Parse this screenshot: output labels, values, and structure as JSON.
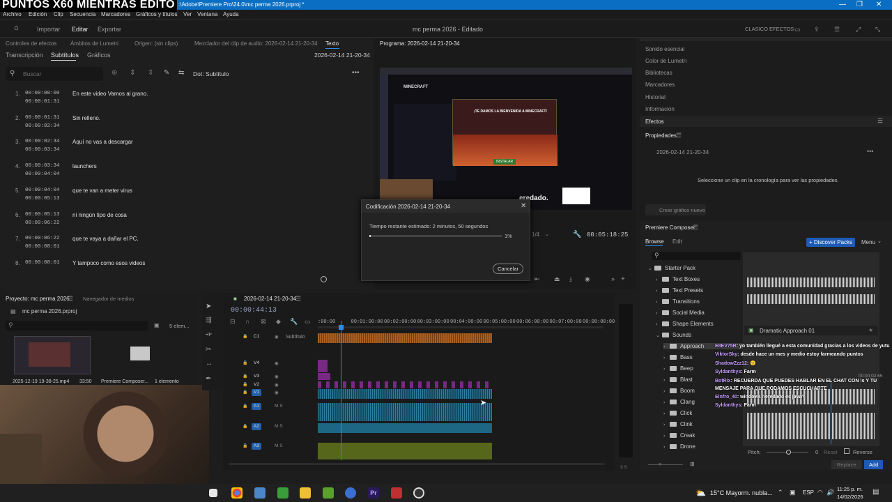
{
  "window": {
    "overlay_text": "PUNTOS X60 MIENTRAS EDITO",
    "path": ":\\Adobe\\Premiere Pro\\24.0\\mc perma 2026.prproj *"
  },
  "menu": [
    "Archivo",
    "Edición",
    "Clip",
    "Secuencia",
    "Marcadores",
    "Gráficos y títulos",
    "Ver",
    "Ventana",
    "Ayuda"
  ],
  "header": {
    "tabs": [
      "Importar",
      "Editar",
      "Exportar"
    ],
    "project_title": "mc perma 2026 - Editado",
    "workspace": "CLASICO EFECTOS"
  },
  "source_tabs": [
    "Controles de efectos",
    "Ámbitos de Lumetri",
    "Origen: (sin clips)",
    "Mezclador del clip de audio: 2026-02-14 21-20-34",
    "Texto"
  ],
  "text_panel": {
    "subtabs": [
      "Transcripción",
      "Subtítulos",
      "Gráficos"
    ],
    "sequence": "2026-02-14 21-20-34",
    "search_placeholder": "Buscar",
    "track_label": "Dot: Subtítulo",
    "rows": [
      {
        "n": "1.",
        "t1": "00:00:00:00",
        "t2": "00:00:01:31",
        "text": "En este video Vamos al grano."
      },
      {
        "n": "2.",
        "t1": "00:00:01:31",
        "t2": "00:00:02:34",
        "text": "Sin relleno."
      },
      {
        "n": "3.",
        "t1": "00:00:02:34",
        "t2": "00:00:03:34",
        "text": "Aquí no vas a descargar"
      },
      {
        "n": "4.",
        "t1": "00:00:03:34",
        "t2": "00:00:04:04",
        "text": "launchers"
      },
      {
        "n": "5.",
        "t1": "00:00:04:04",
        "t2": "00:00:05:13",
        "text": "que te van a meter virus"
      },
      {
        "n": "6.",
        "t1": "00:00:05:13",
        "t2": "00:00:06:22",
        "text": "ni ningún tipo de cosa"
      },
      {
        "n": "7.",
        "t1": "00:00:06:22",
        "t2": "00:00:08:01",
        "text": "que te vaya a dañar el PC."
      },
      {
        "n": "8.",
        "t1": "00:00:08:01",
        "t2": "",
        "text": "Y tampoco como esos videos"
      }
    ]
  },
  "program": {
    "title": "Programa: 2026-02-14 21-20-34",
    "timecode": "00:05:18:25",
    "fit": "1/4",
    "preview": {
      "heading": "¡TE DAMOS LA BIENVENIDA A MINECRAFT!",
      "button": "INSTALAR",
      "brand": "MINECRAFT",
      "overlay": "eredado."
    }
  },
  "encode_dialog": {
    "title": "Codificación 2026-02-14 21-20-34",
    "remaining": "Tiempo restante estimado: 2 minutos, 50 segundos",
    "percent": "1%",
    "progress": 0.01,
    "cancel": "Cancelar"
  },
  "right_panel": {
    "items": [
      "Sonido esencial",
      "Color de Lumetri",
      "Bibliotecas",
      "Marcadores",
      "Historial",
      "Información"
    ],
    "effects": "Efectos",
    "properties": "Propiedades",
    "seq_name": "2026-02-14 21-20-34",
    "hint": "Seleccione un clip en la cronología para ver las propiedades.",
    "create_btn": "Crear gráfico nuevo"
  },
  "composer": {
    "title": "Premiere Composer",
    "tabs": [
      "Browse",
      "Edit"
    ],
    "discover": "+ Discover Packs",
    "menu": "Menu",
    "tree": [
      {
        "label": "Starter Pack",
        "level": 0,
        "open": true
      },
      {
        "label": "Text Boxes",
        "level": 1
      },
      {
        "label": "Text Presets",
        "level": 1
      },
      {
        "label": "Transitions",
        "level": 1
      },
      {
        "label": "Social Media",
        "level": 1
      },
      {
        "label": "Shape Elements",
        "level": 1
      },
      {
        "label": "Sounds",
        "level": 1,
        "open": true
      },
      {
        "label": "Approach",
        "level": 2,
        "selected": true
      },
      {
        "label": "Bass",
        "level": 2
      },
      {
        "label": "Beep",
        "level": 2
      },
      {
        "label": "Blast",
        "level": 2
      },
      {
        "label": "Boom",
        "level": 2
      },
      {
        "label": "Clang",
        "level": 2
      },
      {
        "label": "Click",
        "level": 2
      },
      {
        "label": "Clink",
        "level": 2
      },
      {
        "label": "Creak",
        "level": 2
      },
      {
        "label": "Drone",
        "level": 2
      }
    ],
    "preview_name": "Dramatic Approach 01",
    "preview_time": "00:00:02.65",
    "pitch_label": "Pitch:",
    "pitch_value": "0",
    "reset": "Reset",
    "reverse": "Reverse",
    "replace": "Replace",
    "add": "Add"
  },
  "chat": [
    {
      "user": "E8EV75R",
      "msg": ": yo también llegué a esta comunidad gracias a los videos de yutu"
    },
    {
      "user": "ViktorSky",
      "msg": ": desde hace un mes y medio estoy farmeando puntos"
    },
    {
      "user": "ShadowZzz12",
      "msg": ": 🙂"
    },
    {
      "user": "Syldanthys",
      "msg": ": Farm"
    },
    {
      "user": "BotRix",
      "msg": ": RECUERDA QUE PUEDES HABLAR EN EL CHAT CON !s Y TU"
    },
    {
      "user": "",
      "msg": "MENSAJE PARA QUE PODAMOS ESCUCHARTE"
    },
    {
      "user": "Elnfro_40",
      "msg": ": windows heredado es java?"
    },
    {
      "user": "Syldanthys",
      "msg": ": Farm"
    }
  ],
  "project": {
    "title": "Proyecto: mc perma 2026",
    "media_nav": "Navegador de medios",
    "file": "mc perma 2026.prproj",
    "count": "5 elem...",
    "clip1_name": "2025-12-19 19-38-25.mp4",
    "clip1_dur": "33:50",
    "clip2_name": "Premiere Composer...",
    "clip2_meta": "1 elemento"
  },
  "timeline": {
    "sequence": "2026-02-14 21-20-34",
    "timecode": "00:00:44:13",
    "ruler": [
      ":00:00",
      "00:01:00:00",
      "00:02:00:00",
      "00:03:00:00",
      "00:04:00:00",
      "00:05:00:00",
      "00:06:00:00",
      "00:07:00:00",
      "00:08:00:00"
    ],
    "tracks": [
      "C1",
      "V4",
      "V3",
      "V2",
      "V1",
      "A1",
      "A2",
      "A3"
    ],
    "c1_name": "Subtítulo"
  },
  "taskbar": {
    "weather": "15°C  Mayorm. nubla...",
    "lang": "ESP",
    "time": "11:25 p. m.",
    "date": "14/02/2026"
  }
}
